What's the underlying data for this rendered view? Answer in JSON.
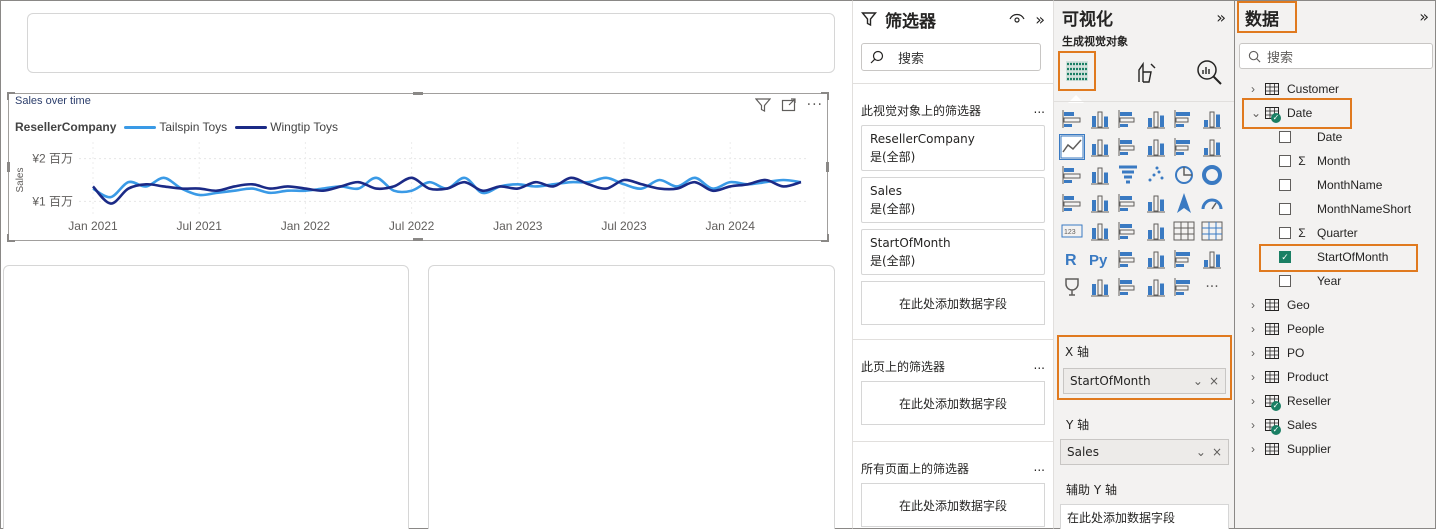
{
  "report": {
    "visual": {
      "title": "Sales over time",
      "legend_title": "ResellerCompany",
      "series": [
        {
          "name": "Tailspin Toys",
          "color": "#3a9ae6"
        },
        {
          "name": "Wingtip Toys",
          "color": "#1b2a86"
        }
      ],
      "y_ticks": [
        "¥2 百万",
        "¥1 百万"
      ],
      "y_axis_label": "Sales",
      "x_ticks": [
        "Jan 2021",
        "Jul 2021",
        "Jan 2022",
        "Jul 2022",
        "Jan 2023",
        "Jul 2023",
        "Jan 2024"
      ]
    }
  },
  "chart_data": {
    "type": "line",
    "title": "Sales over time",
    "xlabel": "",
    "ylabel": "Sales",
    "y_unit": "¥ 百万",
    "ylim": [
      0.8,
      2.2
    ],
    "x_ticks": [
      "Jan 2021",
      "Jul 2021",
      "Jan 2022",
      "Jul 2022",
      "Jan 2023",
      "Jul 2023",
      "Jan 2024"
    ],
    "x": [
      "2021-01",
      "2021-02",
      "2021-03",
      "2021-04",
      "2021-05",
      "2021-06",
      "2021-07",
      "2021-08",
      "2021-09",
      "2021-10",
      "2021-11",
      "2021-12",
      "2022-01",
      "2022-02",
      "2022-03",
      "2022-04",
      "2022-05",
      "2022-06",
      "2022-07",
      "2022-08",
      "2022-09",
      "2022-10",
      "2022-11",
      "2022-12",
      "2023-01",
      "2023-02",
      "2023-03",
      "2023-04",
      "2023-05",
      "2023-06",
      "2023-07",
      "2023-08",
      "2023-09",
      "2023-10",
      "2023-11",
      "2023-12",
      "2024-01",
      "2024-02",
      "2024-03",
      "2024-04",
      "2024-05"
    ],
    "series": [
      {
        "name": "Tailspin Toys",
        "color": "#3a9ae6",
        "values": [
          1.3,
          1.1,
          1.45,
          1.35,
          1.55,
          1.3,
          1.15,
          1.2,
          1.25,
          1.3,
          1.2,
          1.25,
          1.25,
          1.3,
          1.35,
          1.3,
          1.55,
          1.25,
          1.25,
          1.45,
          1.3,
          1.55,
          1.2,
          1.35,
          1.4,
          1.35,
          1.4,
          1.45,
          1.45,
          1.55,
          1.4,
          1.3,
          1.5,
          1.35,
          1.55,
          1.3,
          1.45,
          1.4,
          1.45,
          1.5,
          1.45
        ]
      },
      {
        "name": "Wingtip Toys",
        "color": "#1b2a86",
        "values": [
          1.35,
          0.95,
          1.3,
          1.4,
          1.35,
          1.3,
          1.3,
          1.25,
          1.35,
          1.4,
          1.3,
          1.35,
          1.3,
          1.25,
          1.35,
          1.45,
          1.3,
          1.35,
          1.55,
          1.3,
          1.3,
          1.45,
          1.25,
          1.35,
          1.3,
          1.45,
          1.35,
          1.55,
          1.4,
          1.3,
          1.5,
          1.4,
          1.3,
          1.3,
          1.45,
          1.25,
          1.35,
          1.4,
          1.5,
          1.35,
          1.45
        ]
      }
    ],
    "grid": true,
    "legend": "top-left"
  },
  "filters_pane": {
    "title": "筛选器",
    "search_placeholder": "搜索",
    "visual_section": "此视觉对象上的筛选器",
    "visual_filters": [
      {
        "field": "ResellerCompany",
        "value": "是(全部)"
      },
      {
        "field": "Sales",
        "value": "是(全部)"
      },
      {
        "field": "StartOfMonth",
        "value": "是(全部)"
      }
    ],
    "add_field": "在此处添加数据字段",
    "page_section": "此页上的筛选器",
    "all_pages_section": "所有页面上的筛选器",
    "more": "..."
  },
  "viz_pane": {
    "title": "可视化",
    "build_label": "生成视觉对象",
    "x_axis_label": "X 轴",
    "x_axis_field": "StartOfMonth",
    "y_axis_label": "Y 轴",
    "y_axis_field": "Sales",
    "secondary_y_label": "辅助 Y 轴",
    "add_field": "在此处添加数据字段",
    "more_icon": "···",
    "accent": "#1a7f64"
  },
  "data_pane": {
    "title": "数据",
    "search_placeholder": "搜索",
    "tables": [
      {
        "name": "Customer",
        "expanded": false,
        "has_badge": false
      },
      {
        "name": "Date",
        "expanded": true,
        "has_badge": true,
        "fields": [
          {
            "name": "Date",
            "sigma": false,
            "checked": false
          },
          {
            "name": "Month",
            "sigma": true,
            "checked": false
          },
          {
            "name": "MonthName",
            "sigma": false,
            "checked": false
          },
          {
            "name": "MonthNameShort",
            "sigma": false,
            "checked": false
          },
          {
            "name": "Quarter",
            "sigma": true,
            "checked": false
          },
          {
            "name": "StartOfMonth",
            "sigma": false,
            "checked": true
          },
          {
            "name": "Year",
            "sigma": false,
            "checked": false
          }
        ]
      },
      {
        "name": "Geo",
        "expanded": false,
        "has_badge": false
      },
      {
        "name": "People",
        "expanded": false,
        "has_badge": false
      },
      {
        "name": "PO",
        "expanded": false,
        "has_badge": false
      },
      {
        "name": "Product",
        "expanded": false,
        "has_badge": false
      },
      {
        "name": "Reseller",
        "expanded": false,
        "has_badge": true
      },
      {
        "name": "Sales",
        "expanded": false,
        "has_badge": true
      },
      {
        "name": "Supplier",
        "expanded": false,
        "has_badge": false
      }
    ]
  },
  "colors": {
    "highlight": "#e07a1f",
    "check": "#1a7f64"
  }
}
